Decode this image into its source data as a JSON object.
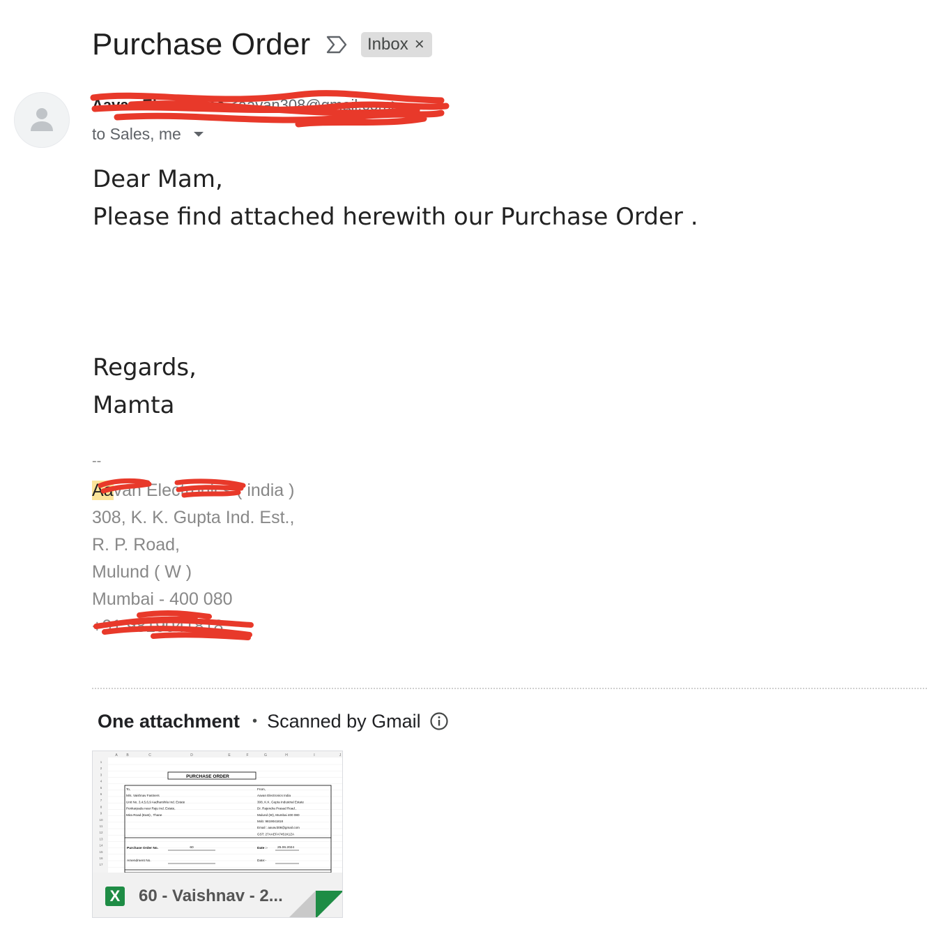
{
  "subject": "Purchase Order",
  "label": {
    "text": "Inbox",
    "remove": "×"
  },
  "sender": {
    "name": "Aavan Electronics",
    "email": "<aavan308@gmail.com>"
  },
  "recipients": "to Sales, me",
  "body": {
    "greeting": "Dear Mam,",
    "line1": "Please find attached herewith our Purchase Order .",
    "regards": "Regards,",
    "name": "Mamta"
  },
  "signature": {
    "dash": "--",
    "company_highlight": "Aa",
    "company_rest": "van Electronics ( india )",
    "address1": "308, K. K. Gupta Ind. Est.,",
    "address2": "R. P. Road,",
    "address3": "Mulund ( W )",
    "address4": "Mumbai - 400 080",
    "phone": "+91 9819041818"
  },
  "attachments": {
    "count_label": "One attachment",
    "separator": "•",
    "scan_label": "Scanned by Gmail",
    "file": {
      "name": "60 - Vaishnav - 2...",
      "type_letter": "X"
    },
    "preview": {
      "col_headers": [
        "A",
        "B",
        "C",
        "D",
        "E",
        "F",
        "G",
        "H",
        "I",
        "J"
      ],
      "row_numbers": [
        "1",
        "2",
        "3",
        "4",
        "5",
        "6",
        "7",
        "8",
        "9",
        "10",
        "11",
        "12",
        "13",
        "14",
        "15",
        "16",
        "17"
      ],
      "title": "PURCHASE ORDER",
      "to_lines": [
        "To,",
        "M/s. Vaishnav Fastners",
        "Unit No. 3,4,5,6,9 Aadharshila Ind. Estate",
        "Penkarpada near Raju Ind. Estate,",
        "Mira Road (East) , Thane"
      ],
      "from_lines": [
        "From,",
        "Aavan Electronics India",
        "308, K.K. Gupta Industrial Estate",
        "Dr. Rajendra Prasad Road ,",
        "Mulund (W), Mumbai 400 080",
        "Mob: 9819041818",
        "Email : aavav308@gmail.com",
        "GST: 27AAEFA7451K1ZA"
      ],
      "po_label": "Purchase Order No.",
      "po_value": "60",
      "date_label": "Date :-",
      "date_value": "25.06.2024",
      "amend_label": "Amendment No.",
      "amend_date_label": "Date:-"
    }
  },
  "colors": {
    "highlight": "#fbe49a",
    "excel_green": "#1e8c45",
    "redaction": "#e8392a"
  }
}
